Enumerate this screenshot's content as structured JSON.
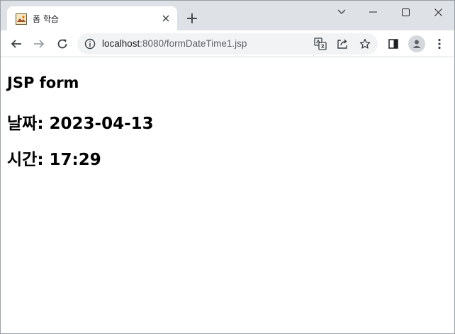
{
  "browser": {
    "tab": {
      "title": "폼 학습",
      "close_glyph": "✕"
    },
    "new_tab_glyph": "+",
    "address": {
      "host": "localhost",
      "path": ":8080/formDateTime1.jsp"
    },
    "icons": [
      "back-icon",
      "forward-icon",
      "reload-icon",
      "info-icon",
      "translate-icon",
      "share-icon",
      "star-icon",
      "side-panel-icon",
      "profile-icon",
      "menu-icon",
      "tab-search-icon",
      "minimize-icon",
      "maximize-icon",
      "close-icon"
    ]
  },
  "page": {
    "heading": "JSP form",
    "date_line": "날짜: 2023-04-13",
    "time_line": "시간: 17:29"
  }
}
